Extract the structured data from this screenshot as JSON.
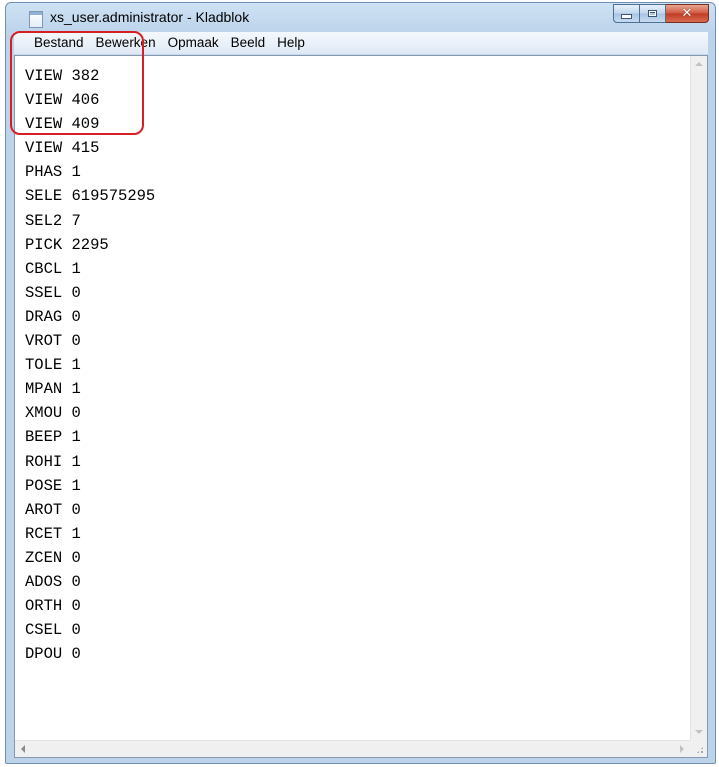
{
  "window": {
    "title": "xs_user.administrator - Kladblok",
    "close_glyph": "✕"
  },
  "menu": [
    "Bestand",
    "Bewerken",
    "Opmaak",
    "Beeld",
    "Help"
  ],
  "editor": {
    "lines": [
      "VIEW 382",
      "VIEW 406",
      "VIEW 409",
      "VIEW 415",
      "PHAS 1",
      "SELE 619575295",
      "SEL2 7",
      "PICK 2295",
      "CBCL 1",
      "SSEL 0",
      "DRAG 0",
      "VROT 0",
      "TOLE 1",
      "MPAN 1",
      "XMOU 0",
      "BEEP 1",
      "ROHI 1",
      "POSE 1",
      "AROT 0",
      "RCET 1",
      "ZCEN 0",
      "ADOS 0",
      "ORTH 0",
      "CSEL 0",
      "DPOU 0"
    ]
  },
  "annotation": {
    "color": "#d61f25"
  },
  "icons": {
    "app": "notepad-icon",
    "minimize": "minimize-icon",
    "maximize": "maximize-icon",
    "close": "close-icon"
  }
}
